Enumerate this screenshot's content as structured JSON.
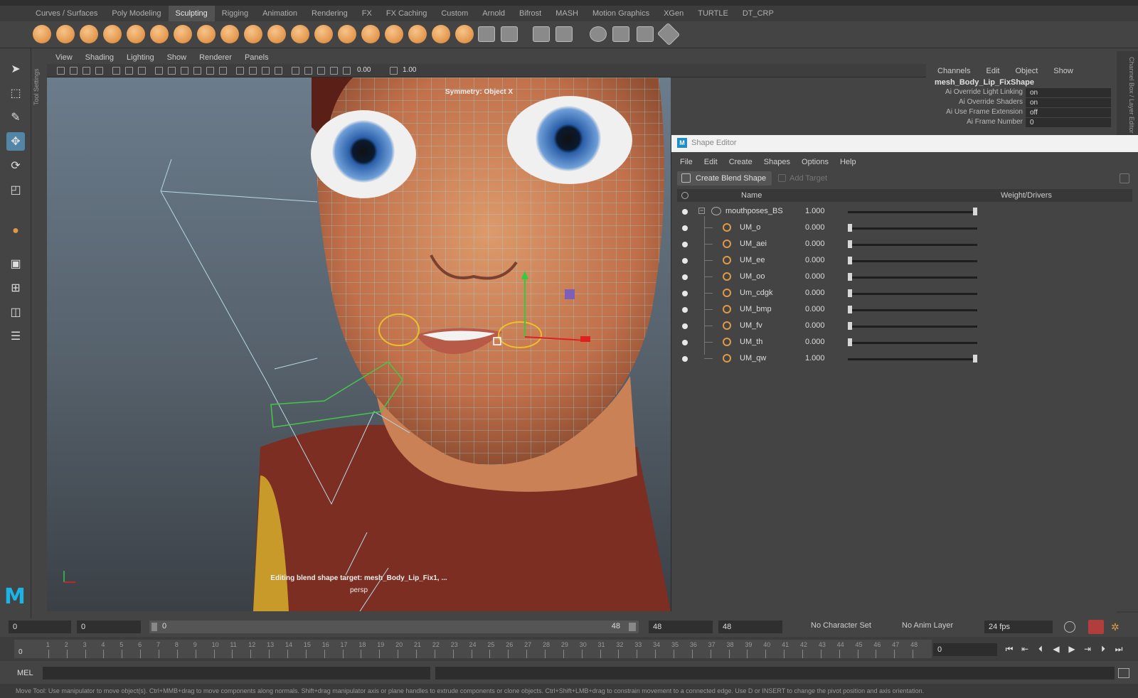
{
  "shelf_tabs": [
    "Curves / Surfaces",
    "Poly Modeling",
    "Sculpting",
    "Rigging",
    "Animation",
    "Rendering",
    "FX",
    "FX Caching",
    "Custom",
    "Arnold",
    "Bifrost",
    "MASH",
    "Motion Graphics",
    "XGen",
    "TURTLE",
    "DT_CRP"
  ],
  "active_shelf_tab": "Sculpting",
  "viewport": {
    "menu": [
      "View",
      "Shading",
      "Lighting",
      "Show",
      "Renderer",
      "Panels"
    ],
    "toolbar_value_1": "0.00",
    "toolbar_value_2": "1.00",
    "symmetry_label": "Symmetry: Object X",
    "status_text": "Editing blend shape target: mesh_Body_Lip_Fix1, ...",
    "camera_label": "persp"
  },
  "tool_settings_label": "Tool Settings",
  "channel_box": {
    "menu": [
      "Channels",
      "Edit",
      "Object",
      "Show"
    ],
    "object_name": "mesh_Body_Lip_FixShape",
    "attributes": [
      {
        "label": "Ai Override Light Linking",
        "value": "on"
      },
      {
        "label": "Ai Override Shaders",
        "value": "on"
      },
      {
        "label": "Ai Use Frame Extension",
        "value": "off"
      },
      {
        "label": "Ai Frame Number",
        "value": "0"
      }
    ],
    "side_label": "Channel Box / Layer Editor"
  },
  "shape_editor": {
    "title": "Shape Editor",
    "menu": [
      "File",
      "Edit",
      "Create",
      "Shapes",
      "Options",
      "Help"
    ],
    "create_button": "Create Blend Shape",
    "add_target_button": "Add Target",
    "col_name": "Name",
    "col_weight": "Weight/Drivers",
    "blend_shape": {
      "name": "mouthposes_BS",
      "weight": "1.000",
      "weight_value": 1.0
    },
    "targets": [
      {
        "name": "UM_o",
        "weight": "0.000",
        "weight_value": 0.0
      },
      {
        "name": "UM_aei",
        "weight": "0.000",
        "weight_value": 0.0
      },
      {
        "name": "UM_ee",
        "weight": "0.000",
        "weight_value": 0.0
      },
      {
        "name": "UM_oo",
        "weight": "0.000",
        "weight_value": 0.0
      },
      {
        "name": "Um_cdgk",
        "weight": "0.000",
        "weight_value": 0.0
      },
      {
        "name": "UM_bmp",
        "weight": "0.000",
        "weight_value": 0.0
      },
      {
        "name": "UM_fv",
        "weight": "0.000",
        "weight_value": 0.0
      },
      {
        "name": "UM_th",
        "weight": "0.000",
        "weight_value": 0.0
      },
      {
        "name": "UM_qw",
        "weight": "1.000",
        "weight_value": 1.0
      }
    ]
  },
  "range_bar": {
    "start_time": "0",
    "playback_start": "0",
    "slider_start": "0",
    "slider_end": "48",
    "playback_end": "48",
    "end_time": "48",
    "character_set": "No Character Set",
    "anim_layer": "No Anim Layer",
    "fps": "24 fps"
  },
  "timeline": {
    "ticks": [
      "1",
      "2",
      "3",
      "4",
      "5",
      "6",
      "7",
      "8",
      "9",
      "10",
      "11",
      "12",
      "13",
      "14",
      "15",
      "16",
      "17",
      "18",
      "19",
      "20",
      "21",
      "22",
      "23",
      "24",
      "25",
      "26",
      "27",
      "28",
      "29",
      "30",
      "31",
      "32",
      "33",
      "34",
      "35",
      "36",
      "37",
      "38",
      "39",
      "40",
      "41",
      "42",
      "43",
      "44",
      "45",
      "46",
      "47",
      "48"
    ],
    "current_frame": "0",
    "playhead_label": "0"
  },
  "command_line": {
    "label": "MEL"
  },
  "help_line": "Move Tool: Use manipulator to move object(s). Ctrl+MMB+drag to move components along normals. Shift+drag manipulator axis or plane handles to extrude components or clone objects. Ctrl+Shift+LMB+drag to constrain movement to a connected edge. Use D or INSERT to change the pivot position and axis orientation.",
  "colors": {
    "accent": "#5285a6",
    "skin": "#c87a4e",
    "wire": "#7fd6e6",
    "target_icon": "#e09a45"
  }
}
